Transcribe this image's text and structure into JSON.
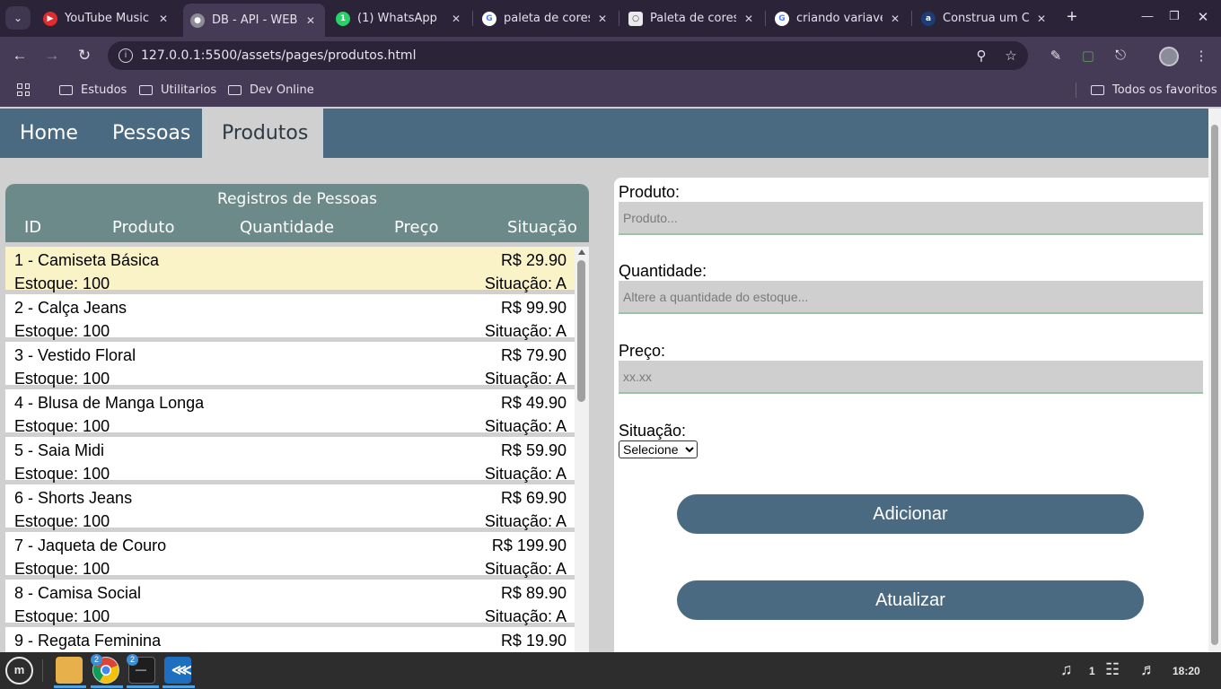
{
  "browser": {
    "tabs": [
      {
        "title": "YouTube Music",
        "favicon": "youtube-music-icon",
        "color": "#e02c2c",
        "active": false
      },
      {
        "title": "DB - API - WEB",
        "favicon": "globe-icon",
        "color": "#8c8c96",
        "active": true
      },
      {
        "title": "(1) WhatsApp",
        "favicon": "whatsapp-icon",
        "color": "#25d366",
        "active": false
      },
      {
        "title": "paleta de cores",
        "favicon": "google-icon",
        "color": "#4285f4",
        "active": false
      },
      {
        "title": "Paleta de cores",
        "favicon": "palette-site-icon",
        "color": "#eaeaea",
        "active": false
      },
      {
        "title": "criando variavel",
        "favicon": "google-icon",
        "color": "#4285f4",
        "active": false
      },
      {
        "title": "Construa um CS",
        "favicon": "alura-icon",
        "color": "#1c3e78",
        "active": false
      }
    ],
    "url": "127.0.0.1:5500/assets/pages/produtos.html",
    "bookmarks": [
      "Estudos",
      "Utilitarios",
      "Dev Online"
    ],
    "all_bookmarks": "Todos os favoritos"
  },
  "nav": {
    "items": [
      "Home",
      "Pessoas",
      "Produtos"
    ],
    "active": "Produtos"
  },
  "records": {
    "title": "Registros de Pessoas",
    "columns": [
      "ID",
      "Produto",
      "Quantidade",
      "Preço",
      "Situação"
    ],
    "rows": [
      {
        "name": "1 - Camiseta Básica",
        "price": "R$ 29.90",
        "stock": "Estoque: 100",
        "status": "Situação: A"
      },
      {
        "name": "2 - Calça Jeans",
        "price": "R$ 99.90",
        "stock": "Estoque: 100",
        "status": "Situação: A"
      },
      {
        "name": "3 - Vestido Floral",
        "price": "R$ 79.90",
        "stock": "Estoque: 100",
        "status": "Situação: A"
      },
      {
        "name": "4 - Blusa de Manga Longa",
        "price": "R$ 49.90",
        "stock": "Estoque: 100",
        "status": "Situação: A"
      },
      {
        "name": "5 - Saia Midi",
        "price": "R$ 59.90",
        "stock": "Estoque: 100",
        "status": "Situação: A"
      },
      {
        "name": "6 - Shorts Jeans",
        "price": "R$ 69.90",
        "stock": "Estoque: 100",
        "status": "Situação: A"
      },
      {
        "name": "7 - Jaqueta de Couro",
        "price": "R$ 199.90",
        "stock": "Estoque: 100",
        "status": "Situação: A"
      },
      {
        "name": "8 - Camisa Social",
        "price": "R$ 89.90",
        "stock": "Estoque: 100",
        "status": "Situação: A"
      },
      {
        "name": "9 - Regata Feminina",
        "price": "R$ 19.90",
        "stock": "",
        "status": ""
      }
    ]
  },
  "form": {
    "produto_label": "Produto:",
    "produto_placeholder": "Produto...",
    "produto_value": "",
    "quantidade_label": "Quantidade:",
    "quantidade_placeholder": "Altere a quantidade do estoque...",
    "quantidade_value": "",
    "preco_label": "Preço:",
    "preco_placeholder": "xx.xx",
    "preco_value": "",
    "situacao_label": "Situação:",
    "situacao_selected": "Selecione",
    "add_label": "Adicionar",
    "update_label": "Atualizar"
  },
  "taskbar": {
    "badges": {
      "chrome": "2",
      "terminal": "2"
    },
    "notifications": "1",
    "time": "18:20"
  },
  "colors": {
    "nav_bg": "#4a6a82",
    "records_header": "#6d8a8a",
    "highlight_row": "#faf3c8",
    "button_bg": "#4a6a82",
    "input_bg": "#cfcfcf"
  }
}
